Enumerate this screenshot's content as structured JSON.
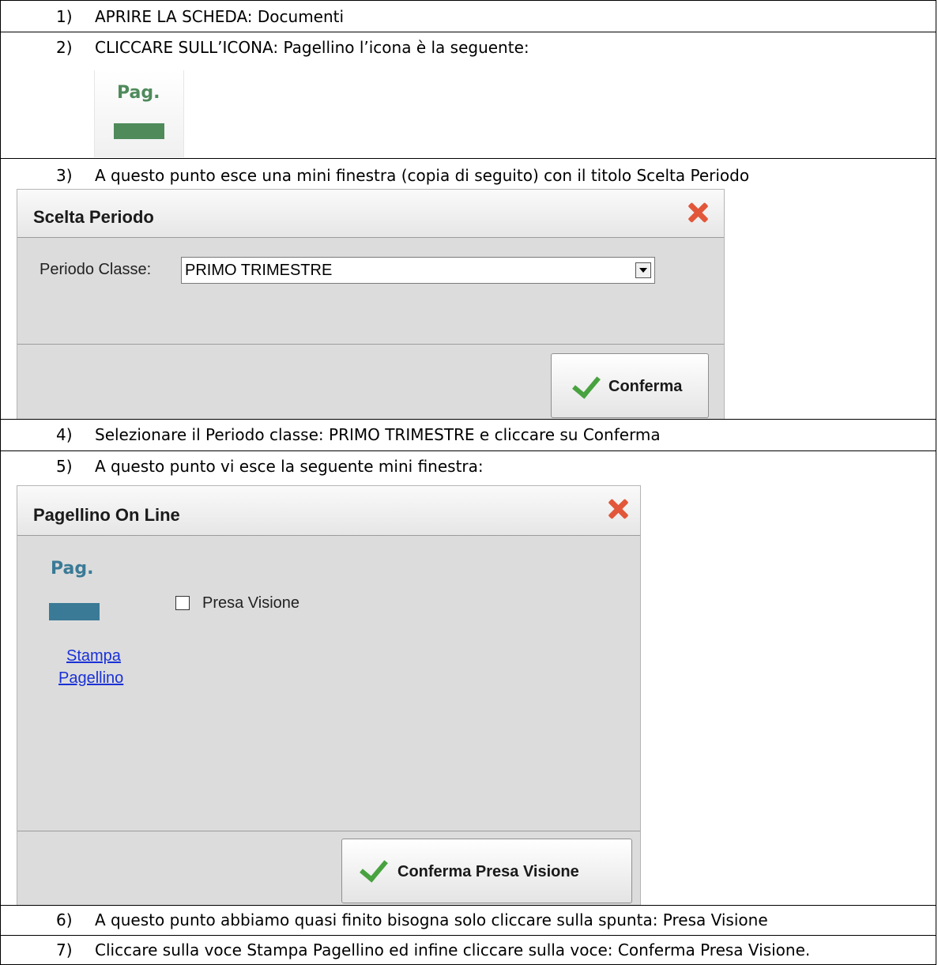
{
  "steps": [
    {
      "num": "1)",
      "text": "APRIRE LA SCHEDA: Documenti"
    },
    {
      "num": "2)",
      "text": "CLICCARE SULL’ICONA: Pagellino l’icona è la seguente:"
    },
    {
      "num": "3)",
      "text": "A questo punto esce una mini finestra (copia di seguito) con il titolo Scelta Periodo"
    },
    {
      "num": "4)",
      "text": "Selezionare il Periodo classe: PRIMO TRIMESTRE e cliccare su Conferma"
    },
    {
      "num": "5)",
      "text": "A questo punto vi esce la seguente mini finestra:"
    },
    {
      "num": "6)",
      "text": "A questo punto abbiamo quasi finito bisogna solo cliccare sulla spunta: Presa Visione"
    },
    {
      "num": "7)",
      "text": "Cliccare sulla voce Stampa Pagellino ed infine cliccare sulla voce: Conferma Presa Visione."
    }
  ],
  "icon_sample": {
    "label": "Pag.",
    "color": "#4f8a5b",
    "icon": "pagellino-icon"
  },
  "dialog_periodo": {
    "title": "Scelta Periodo",
    "field_label": "Periodo Classe:",
    "selected": "PRIMO TRIMESTRE",
    "confirm": "Conferma",
    "close_icon": "close-icon",
    "accent": "#48a23f"
  },
  "dialog_pagellino": {
    "title": "Pagellino On Line",
    "icon_label": "Pag.",
    "icon_color": "#3a7a96",
    "link_line1": "Stampa",
    "link_line2": "Pagellino",
    "checkbox_label": "Presa Visione",
    "checkbox_checked": false,
    "confirm": "Conferma Presa Visione"
  }
}
